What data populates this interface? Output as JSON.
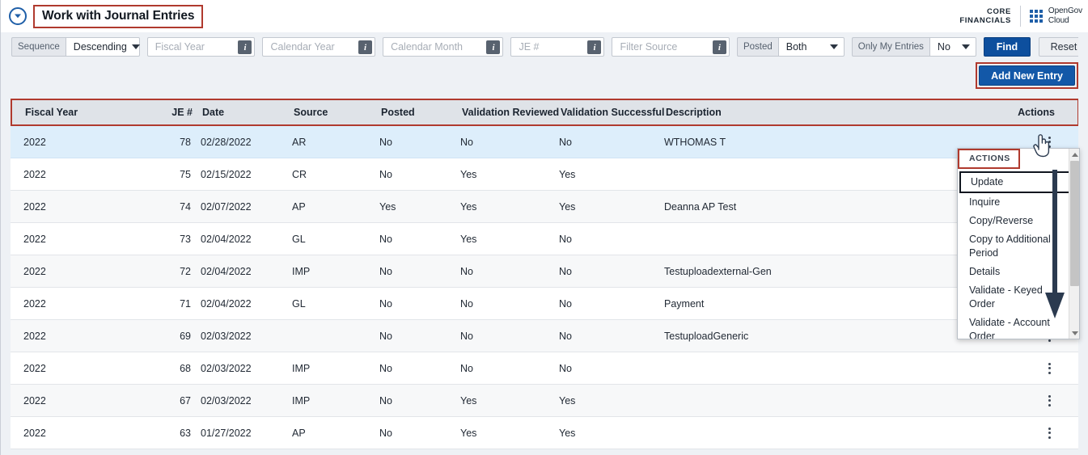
{
  "header": {
    "title": "Work with Journal Entries",
    "collapse_icon": "chevron-down-circle-icon",
    "brand_core_line1": "CORE",
    "brand_core_line2": "FINANCIALS",
    "waffle_icon": "app-grid-icon",
    "brand_og_line1": "OpenGov",
    "brand_og_line2": "Cloud"
  },
  "filters": {
    "sequence_label": "Sequence",
    "sequence_value": "Descending",
    "fiscal_year_placeholder": "Fiscal Year",
    "fiscal_year_value": "",
    "calendar_year_placeholder": "Calendar Year",
    "calendar_year_value": "",
    "calendar_month_placeholder": "Calendar Month",
    "calendar_month_value": "",
    "je_number_placeholder": "JE #",
    "je_number_value": "",
    "filter_source_placeholder": "Filter Source",
    "filter_source_value": "",
    "posted_label": "Posted",
    "posted_value": "Both",
    "only_my_entries_label": "Only My Entries",
    "only_my_entries_value": "No",
    "find_label": "Find",
    "reset_label": "Reset",
    "info_icon": "info-icon"
  },
  "toolbar": {
    "add_new_entry_label": "Add New Entry"
  },
  "grid": {
    "columns": [
      "Fiscal Year",
      "JE #",
      "Date",
      "Source",
      "Posted",
      "Validation Reviewed",
      "Validation Successful",
      "Description",
      "Actions"
    ],
    "rows": [
      {
        "fiscal_year": "2022",
        "je": "78",
        "date": "02/28/2022",
        "source": "AR",
        "posted": "No",
        "validation_reviewed": "No",
        "validation_successful": "No",
        "description": "WTHOMAS T"
      },
      {
        "fiscal_year": "2022",
        "je": "75",
        "date": "02/15/2022",
        "source": "CR",
        "posted": "No",
        "validation_reviewed": "Yes",
        "validation_successful": "Yes",
        "description": ""
      },
      {
        "fiscal_year": "2022",
        "je": "74",
        "date": "02/07/2022",
        "source": "AP",
        "posted": "Yes",
        "validation_reviewed": "Yes",
        "validation_successful": "Yes",
        "description": "Deanna AP Test"
      },
      {
        "fiscal_year": "2022",
        "je": "73",
        "date": "02/04/2022",
        "source": "GL",
        "posted": "No",
        "validation_reviewed": "Yes",
        "validation_successful": "No",
        "description": ""
      },
      {
        "fiscal_year": "2022",
        "je": "72",
        "date": "02/04/2022",
        "source": "IMP",
        "posted": "No",
        "validation_reviewed": "No",
        "validation_successful": "No",
        "description": "Testuploadexternal-Gen"
      },
      {
        "fiscal_year": "2022",
        "je": "71",
        "date": "02/04/2022",
        "source": "GL",
        "posted": "No",
        "validation_reviewed": "No",
        "validation_successful": "No",
        "description": "Payment"
      },
      {
        "fiscal_year": "2022",
        "je": "69",
        "date": "02/03/2022",
        "source": "",
        "posted": "No",
        "validation_reviewed": "No",
        "validation_successful": "No",
        "description": "TestuploadGeneric"
      },
      {
        "fiscal_year": "2022",
        "je": "68",
        "date": "02/03/2022",
        "source": "IMP",
        "posted": "No",
        "validation_reviewed": "No",
        "validation_successful": "No",
        "description": ""
      },
      {
        "fiscal_year": "2022",
        "je": "67",
        "date": "02/03/2022",
        "source": "IMP",
        "posted": "No",
        "validation_reviewed": "Yes",
        "validation_successful": "Yes",
        "description": ""
      },
      {
        "fiscal_year": "2022",
        "je": "63",
        "date": "01/27/2022",
        "source": "AP",
        "posted": "No",
        "validation_reviewed": "Yes",
        "validation_successful": "Yes",
        "description": ""
      }
    ],
    "row_action_icon": "kebab-menu-icon"
  },
  "actions_menu": {
    "title": "ACTIONS",
    "items": [
      "Update",
      "Inquire",
      "Copy/Reverse",
      "Copy to Additional Period",
      "Details",
      "Validate - Keyed Order",
      "Validate - Account Order"
    ],
    "scroll_up_icon": "scroll-up-arrow-icon",
    "scroll_down_icon": "scroll-down-arrow-icon"
  },
  "annotations": {
    "arrow_icon": "down-arrow-annotation",
    "cursor_icon": "pointing-hand-cursor"
  },
  "colors": {
    "highlight_box": "#b03a2e",
    "primary_button": "#0d4f9e",
    "add_button": "#1358a8",
    "selected_row": "#ddeefb",
    "brand": "#1f5fa8"
  }
}
